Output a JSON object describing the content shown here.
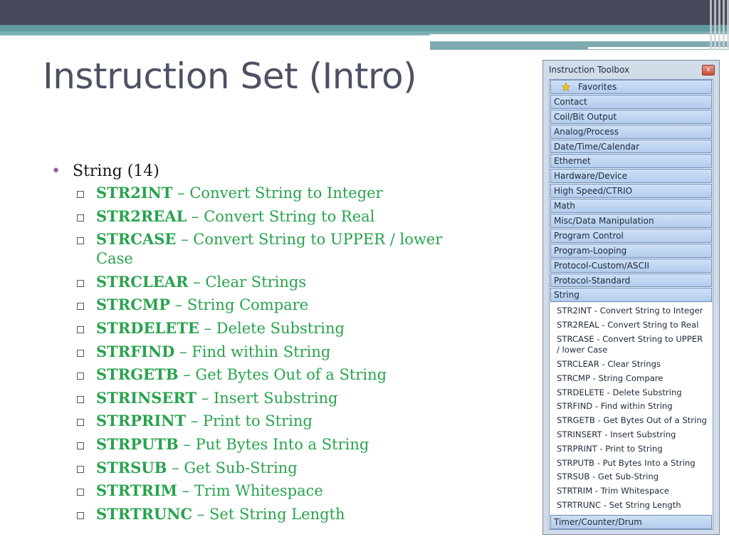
{
  "slide": {
    "title": "Instruction Set (Intro)",
    "bullet": "String (14)",
    "accent_color": "#27a34c",
    "bullet_color": "#8e5ea2",
    "subitems": [
      {
        "code": "STR2INT",
        "desc": " – Convert String to Integer"
      },
      {
        "code": "STR2REAL",
        "desc": " – Convert String to Real"
      },
      {
        "code": "STRCASE",
        "desc": " – Convert String to UPPER / lower Case"
      },
      {
        "code": "STRCLEAR",
        "desc": " – Clear Strings"
      },
      {
        "code": "STRCMP",
        "desc": " – String Compare"
      },
      {
        "code": "STRDELETE",
        "desc": " – Delete Substring"
      },
      {
        "code": "STRFIND",
        "desc": " – Find within String"
      },
      {
        "code": "STRGETB",
        "desc": " – Get Bytes Out of a String"
      },
      {
        "code": "STRINSERT",
        "desc": " – Insert Substring"
      },
      {
        "code": "STRPRINT",
        "desc": " – Print to String"
      },
      {
        "code": "STRPUTB",
        "desc": " – Put Bytes Into a String"
      },
      {
        "code": "STRSUB",
        "desc": " – Get Sub-String"
      },
      {
        "code": "STRTRIM",
        "desc": " – Trim Whitespace"
      },
      {
        "code": "STRTRUNC",
        "desc": " – Set String Length"
      }
    ]
  },
  "toolbox": {
    "title": "Instruction Toolbox",
    "close_glyph": "x",
    "favorites_label": "Favorites",
    "favorites_icon": "star-icon",
    "categories": [
      "Contact",
      "Coil/Bit Output",
      "Analog/Process",
      "Date/Time/Calendar",
      "Ethernet",
      "Hardware/Device",
      "High Speed/CTRIO",
      "Math",
      "Misc/Data Manipulation",
      "Program Control",
      "Program-Looping",
      "Protocol-Custom/ASCII",
      "Protocol-Standard",
      "String"
    ],
    "string_items": [
      "STR2INT - Convert String to Integer",
      "STR2REAL - Convert String to Real",
      "STRCASE - Convert String to UPPER / lower Case",
      "STRCLEAR - Clear Strings",
      "STRCMP - String Compare",
      "STRDELETE - Delete Substring",
      "STRFIND - Find within String",
      "STRGETB - Get Bytes Out of a String",
      "STRINSERT - Insert Substring",
      "STRPRINT - Print to String",
      "STRPUTB - Put Bytes Into a String",
      "STRSUB - Get Sub-String",
      "STRTRIM - Trim Whitespace",
      "STRTRUNC - Set String Length"
    ],
    "last_category": "Timer/Counter/Drum"
  }
}
